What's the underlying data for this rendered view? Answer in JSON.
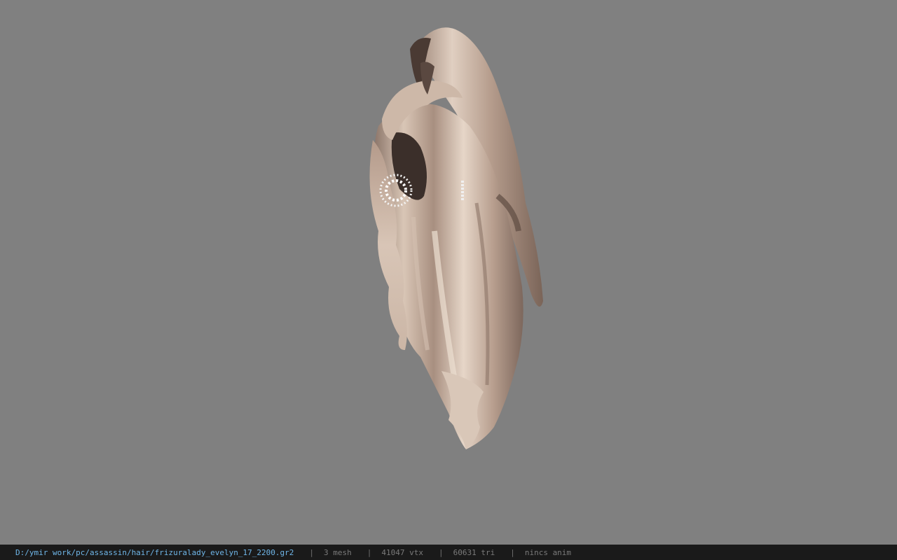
{
  "viewer": {
    "background_color": "#808080",
    "model_icon": "hair-model-icon"
  },
  "statusbar": {
    "file_path": "D:/ymir work/pc/assassin/hair/frizuralady_evelyn_17_2200.gr2",
    "separator": "|",
    "mesh_count": "3 mesh",
    "vertex_count": "41047 vtx",
    "triangle_count": "60631 tri",
    "anim_status": "nincs anim",
    "path_color": "#6fb6e8",
    "stat_color": "#7a7a7a"
  }
}
